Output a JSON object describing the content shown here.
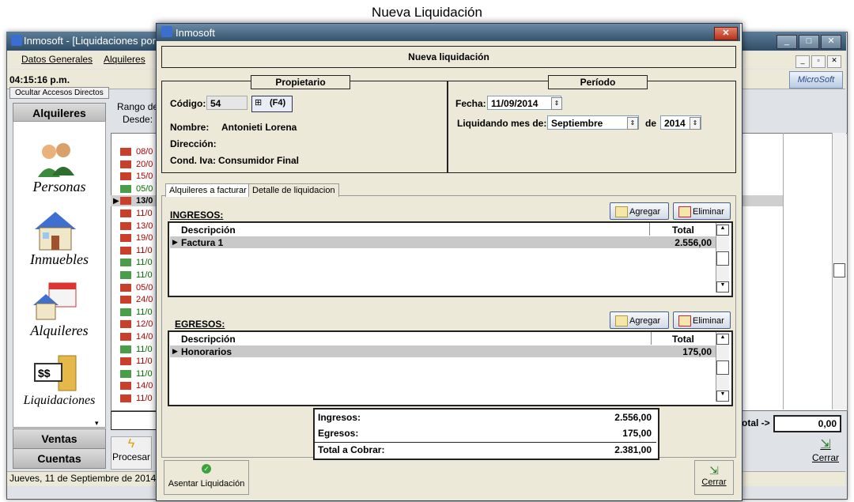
{
  "caption": "Nueva Liquidación",
  "background_window": {
    "title": "Inmosoft - [Liquidaciones por l",
    "menu": [
      "Datos Generales",
      "Alquileres"
    ],
    "clock": "04:15:16 p.m.",
    "ocultar_label": "Ocultar Accesos Directos",
    "sidebar": {
      "header": "Alquileres",
      "items": [
        "Personas",
        "Inmuebles",
        "Alquileres",
        "Liquidaciones"
      ],
      "footer": [
        "Ventas",
        "Cuentas"
      ]
    },
    "rango_label": "Rango de",
    "desde_label": "Desde:",
    "grid_rows": [
      "08/0",
      "20/0",
      "15/0",
      "05/0",
      "13/0",
      "11/0",
      "13/0",
      "19/0",
      "11/0",
      "11/0",
      "11/0",
      "05/0",
      "24/0",
      "11/0",
      "12/0",
      "14/0",
      "11/0",
      "11/0",
      "11/0",
      "14/0",
      "11/0"
    ],
    "total_label": "otal ->",
    "total_value": "0,00",
    "procesar_label": "Procesar",
    "cerrar_label": "Cerrar",
    "status": "Jueves, 11 de Septiembre de 2014",
    "logo_text": "MicroSoft"
  },
  "dialog": {
    "title": "Inmosoft",
    "header": "Nueva liquidación",
    "propietario": {
      "title": "Propietario",
      "codigo_label": "Código:",
      "codigo_value": "54",
      "f4_label": "(F4)",
      "nombre_label": "Nombre:",
      "nombre_value": "Antonieti  Lorena",
      "direccion_label": "Dirección:",
      "cond_iva_label": "Cond. Iva:",
      "cond_iva_value": "Consumidor Final"
    },
    "periodo": {
      "title": "Período",
      "fecha_label": "Fecha:",
      "fecha_value": "11/09/2014",
      "mes_label": "Liquidando mes de:",
      "mes_value": "Septiembre",
      "de_label": "de",
      "anio_value": "2014"
    },
    "tabs": [
      "Alquileres a facturar",
      "Detalle de liquidacion"
    ],
    "ingresos": {
      "title": "INGRESOS:",
      "agregar": "Agregar",
      "eliminar": "Eliminar",
      "columns": [
        "Descripción",
        "Total"
      ],
      "rows": [
        {
          "descripcion": "Factura 1",
          "total": "2.556,00"
        }
      ]
    },
    "egresos": {
      "title": "EGRESOS:",
      "agregar": "Agregar",
      "eliminar": "Eliminar",
      "columns": [
        "Descripción",
        "Total"
      ],
      "rows": [
        {
          "descripcion": "Honorarios",
          "total": "175,00"
        }
      ]
    },
    "summary": {
      "ingresos_label": "Ingresos:",
      "ingresos_value": "2.556,00",
      "egresos_label": "Egresos:",
      "egresos_value": "175,00",
      "total_label": "Total a Cobrar:",
      "total_value": "2.381,00"
    },
    "asentar_label": "Asentar Liquidación",
    "cerrar_label": "Cerrar"
  },
  "colors": {
    "row_red": "#b00000",
    "row_green": "#007000",
    "titlebar": "#35526b"
  }
}
